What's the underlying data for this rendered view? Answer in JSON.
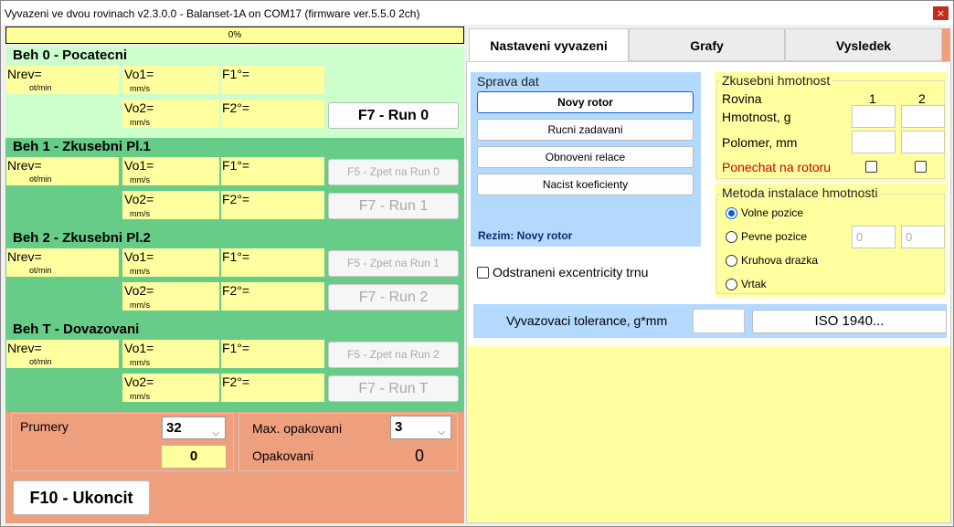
{
  "window": {
    "title": "Vyvazeni ve dvou rovinach v2.3.0.0 - Balanset-1A on COM17 (firmware ver.5.5.0 2ch)",
    "close_glyph": "×"
  },
  "progress": {
    "text": "0%",
    "value_percent": 0
  },
  "units": {
    "rpm": "ot/min",
    "velocity": "mm/s"
  },
  "labels": {
    "nrev": "Nrev=",
    "vo1": "Vo1=",
    "vo2": "Vo2=",
    "f1": "F1°=",
    "f2": "F2°="
  },
  "runs": [
    {
      "title": "Beh 0 - Pocatecni",
      "button_bottom": "F7 - Run 0"
    },
    {
      "title": "Beh 1 - Zkusebni Pl.1",
      "button_top": "F5 - Zpet na Run 0",
      "button_bottom": "F7 - Run 1"
    },
    {
      "title": "Beh 2 - Zkusebni Pl.2",
      "button_top": "F5 - Zpet na Run 1",
      "button_bottom": "F7 - Run 2"
    },
    {
      "title": "Beh T - Dovazovani",
      "button_top": "F5 - Zpet na Run 2",
      "button_bottom": "F7 - Run T"
    }
  ],
  "bottom": {
    "prumery_label": "Prumery",
    "prumery_value": "32",
    "prumery_count": "0",
    "max_opak_label": "Max. opakovani",
    "max_opak_value": "3",
    "opak_label": "Opakovani",
    "opak_value": "0",
    "exit_button": "F10 - Ukoncit"
  },
  "tabs": [
    "Nastaveni vyvazeni",
    "Grafy",
    "Vysledek"
  ],
  "sprava": {
    "title": "Sprava dat",
    "buttons": [
      "Novy rotor",
      "Rucni zadavani",
      "Obnoveni relace",
      "Nacist koeficienty"
    ],
    "mode": "Rezim: Novy rotor"
  },
  "excentricity_label": "Odstraneni excentricity trnu",
  "zkusebni": {
    "title": "Zkusebni hmotnost",
    "plane_label": "Rovina",
    "plane1": "1",
    "plane2": "2",
    "mass_label": "Hmotnost, g",
    "radius_label": "Polomer, mm",
    "keep_label": "Ponechat na rotoru"
  },
  "metoda": {
    "title": "Metoda instalace hmotnosti",
    "options": [
      "Volne pozice",
      "Pevne pozice",
      "Kruhova drazka",
      "Vrtak"
    ],
    "selected": 0,
    "fixed_pos_1": "0",
    "fixed_pos_2": "0"
  },
  "tolerance": {
    "label": "Vyvazovaci tolerance, g*mm",
    "iso_button": "ISO 1940..."
  },
  "colors": {
    "green_light": "#ccffcc",
    "green_dark": "#66cc88",
    "yellow": "#ffffa0",
    "salmon": "#eea07e",
    "blue": "#b3d9ff",
    "red_text": "#cc0000",
    "mode_text": "#102a70"
  }
}
